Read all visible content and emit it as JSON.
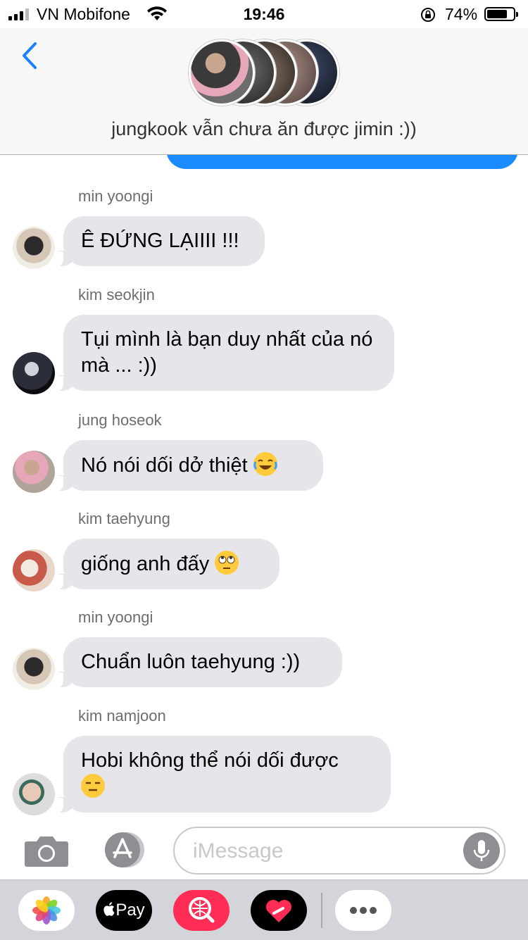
{
  "status_bar": {
    "carrier": "VN Mobifone",
    "time": "19:46",
    "battery_pct": "74%",
    "battery_level": 0.74
  },
  "header": {
    "back_icon": "chevron-left-icon",
    "group_name": "jungkook vẫn chưa ăn được jimin :))",
    "accent_color": "#1a82fb"
  },
  "messages": [
    {
      "sender": "min yoongi",
      "text": "Ê ĐỨNG LẠIIII !!!",
      "emoji": ""
    },
    {
      "sender": "kim seokjin",
      "text": "Tụi mình là bạn duy nhất của nó mà ... :))",
      "emoji": ""
    },
    {
      "sender": "jung hoseok",
      "text": "Nó nói dối dở thiệt",
      "emoji": "face-with-tears-of-joy"
    },
    {
      "sender": "kim taehyung",
      "text": "giống anh đấy",
      "emoji": "face-with-rolling-eyes"
    },
    {
      "sender": "min yoongi",
      "text": "Chuẩn luôn taehyung :))",
      "emoji": ""
    },
    {
      "sender": "kim namjoon",
      "text": "Hobi không thể nói dối được",
      "emoji": "expressionless-face"
    }
  ],
  "input": {
    "placeholder": "iMessage",
    "camera_icon": "camera-icon",
    "apps_icon": "app-store-icon",
    "mic_icon": "microphone-icon"
  },
  "drawer": {
    "apps": [
      "photos-icon",
      "apple-pay-icon",
      "image-search-icon",
      "digital-touch-icon",
      "more-icon"
    ],
    "apple_pay_label": "Pay"
  },
  "colors": {
    "bubble_gray": "#e5e5ea",
    "sent_blue": "#1a8cff",
    "drawer_bg": "#d4d5da"
  }
}
